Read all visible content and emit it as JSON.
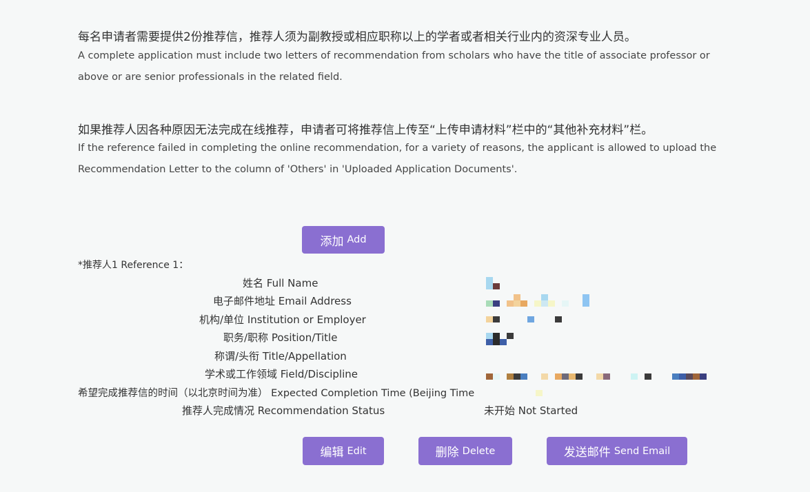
{
  "intro": {
    "para1_cn": "每名申请者需要提供2份推荐信，推荐人须为副教授或相应职称以上的学者或者相关行业内的资深专业人员。",
    "para1_en_line1": "A complete application must include two letters of recommendation from scholars who have the title of associate professor or",
    "para1_en_line2": "above or are senior professionals in the related field.",
    "para2_cn": "如果推荐人因各种原因无法完成在线推荐，申请者可将推荐信上传至“上传申请材料”栏中的“其他补充材料”栏。",
    "para2_en_line1": "If the reference failed in completing the online recommendation, for a variety of reasons, the applicant is allowed to upload the",
    "para2_en_line2": "Recommendation Letter to the column of 'Others' in 'Uploaded Application Documents'."
  },
  "add_button": {
    "cn": "添加",
    "en": "Add"
  },
  "reference": {
    "title": "*推荐人1 Reference 1：",
    "fields": {
      "full_name": "姓名 Full Name",
      "email": "电子邮件地址 Email Address",
      "institution": "机构/单位 Institution or Employer",
      "position": "职务/职称 Position/Title",
      "appellation": "称谓/头衔 Title/Appellation",
      "field": "学术或工作领域 Field/Discipline",
      "completion_time": "希望完成推荐信的时间（以北京时间为准） Expected Completion Time (Beijing Time",
      "status": "推荐人完成情况 Recommendation Status"
    },
    "status_value": "未开始 Not Started"
  },
  "actions": {
    "edit": {
      "cn": "编辑",
      "en": "Edit"
    },
    "delete": {
      "cn": "删除",
      "en": "Delete"
    },
    "send_email": {
      "cn": "发送邮件",
      "en": "Send Email"
    }
  },
  "colors": {
    "accent": "#8a6fd1",
    "background": "#f6f8f8"
  }
}
